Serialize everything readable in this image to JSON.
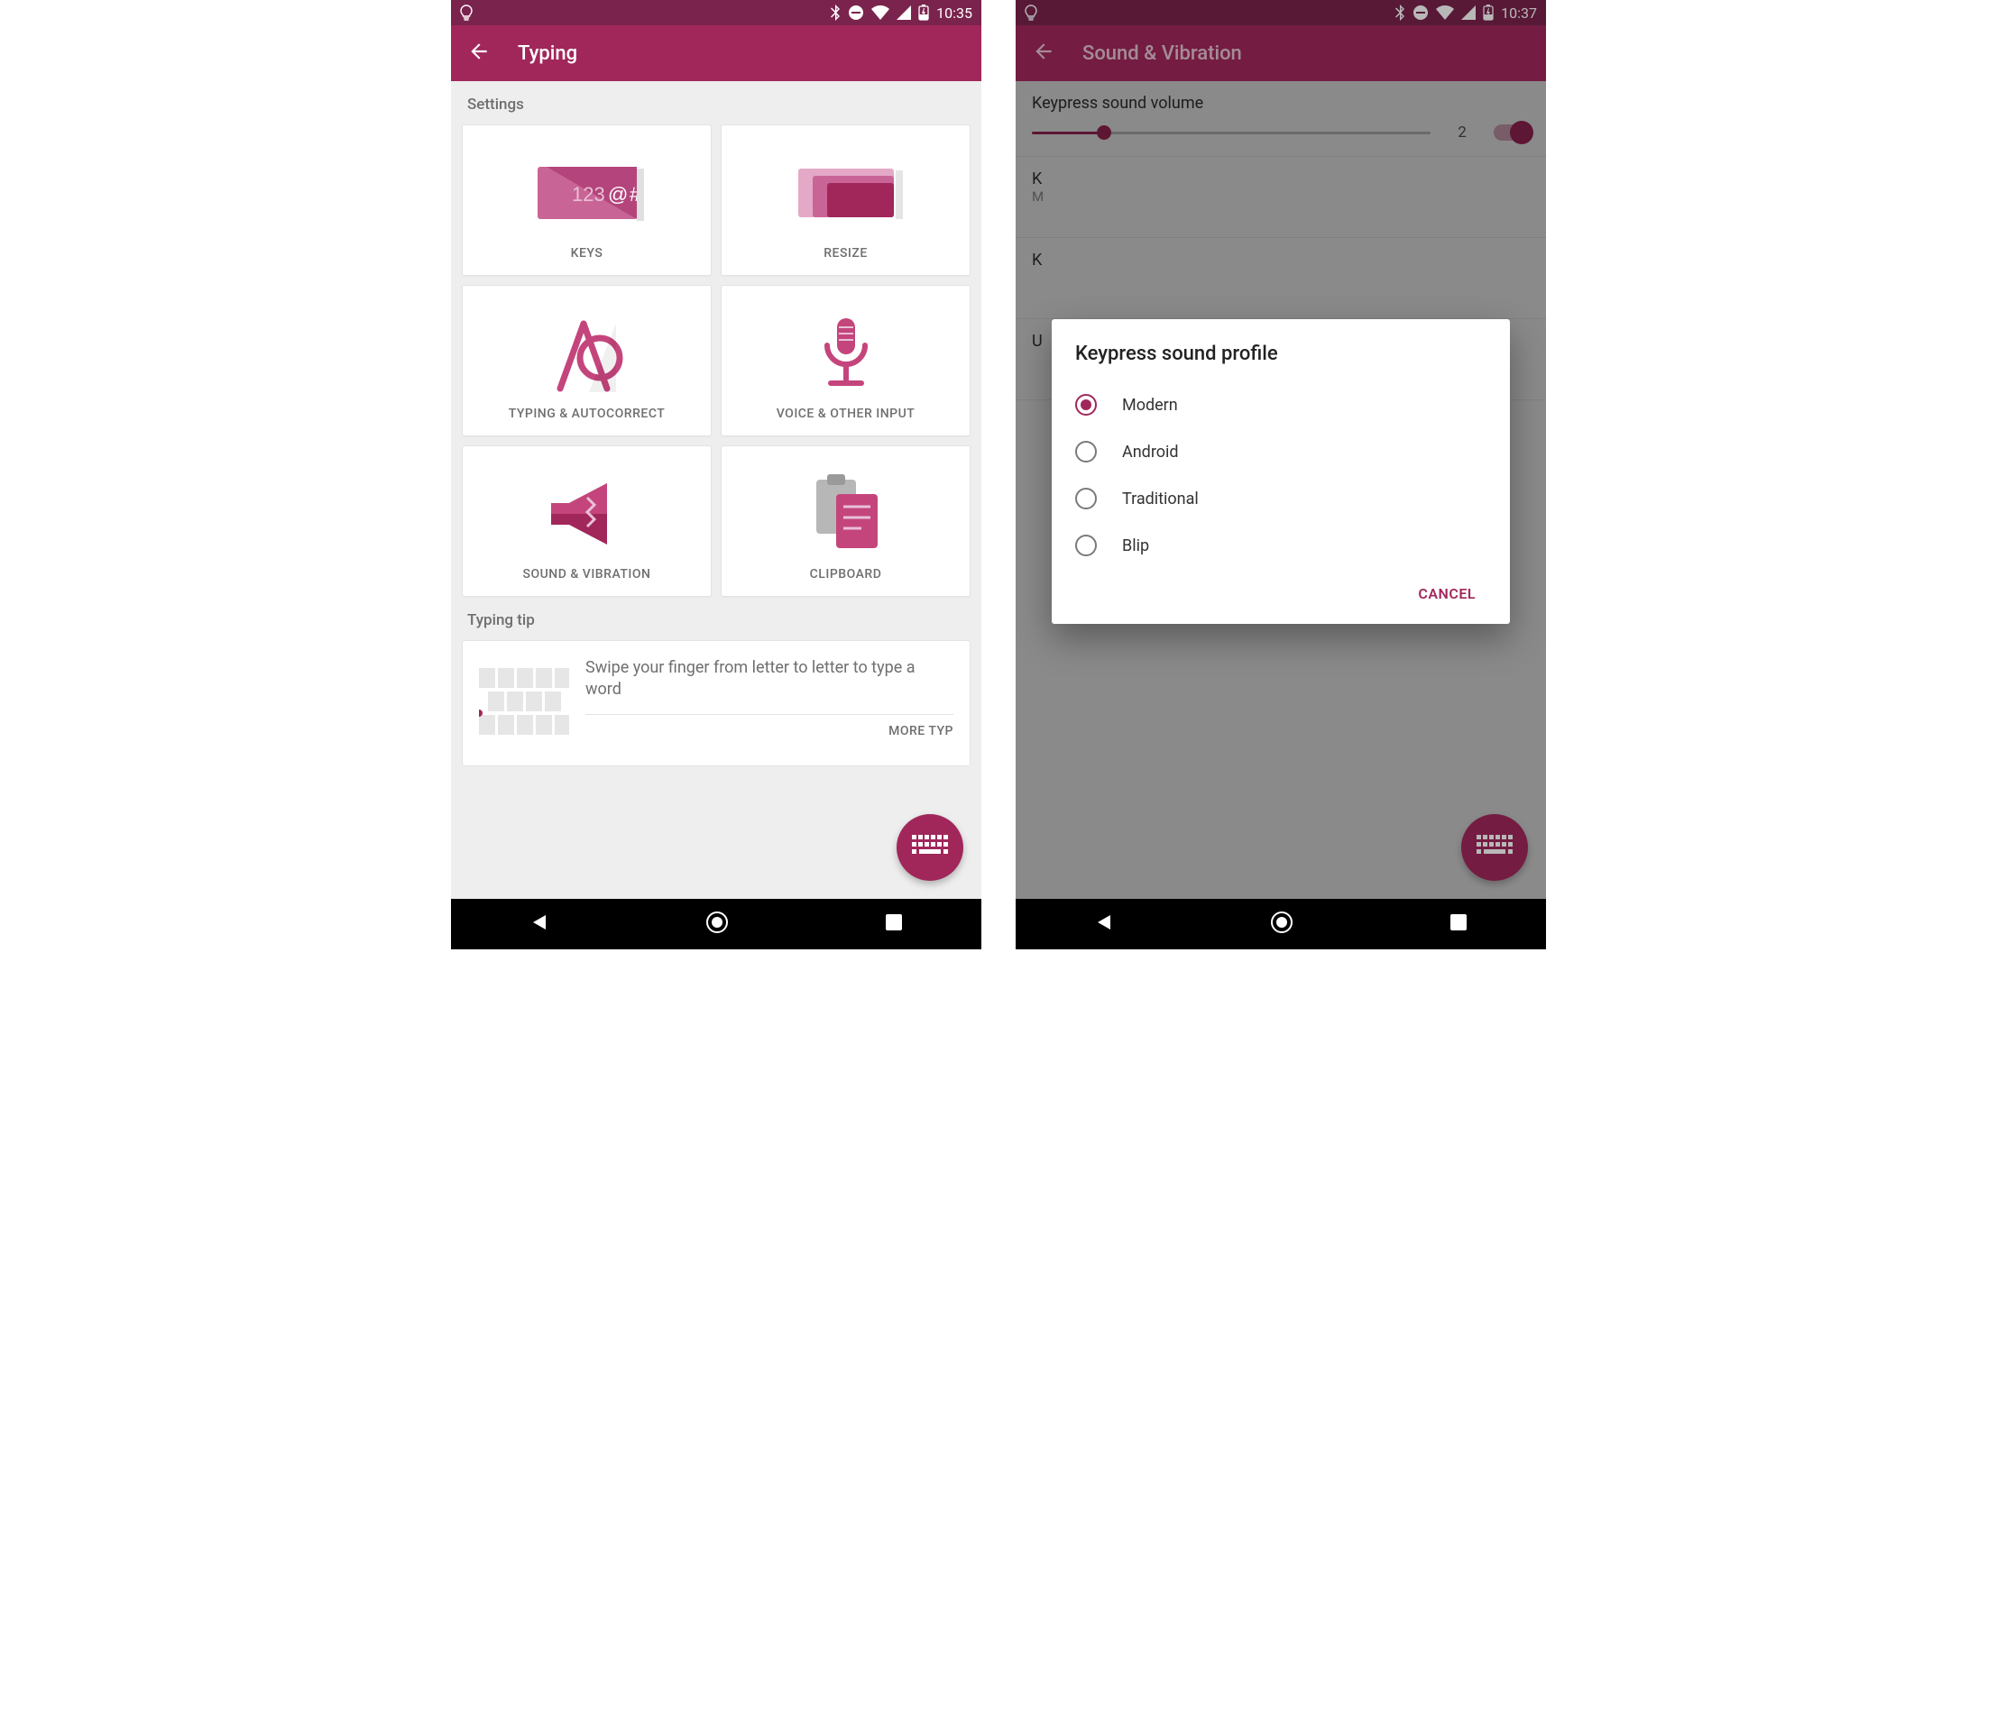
{
  "left": {
    "statusbar": {
      "time": "10:35"
    },
    "appbar": {
      "title": "Typing"
    },
    "sections": {
      "settings_label": "Settings",
      "tiles": [
        {
          "label": "KEYS"
        },
        {
          "label": "RESIZE"
        },
        {
          "label": "TYPING & AUTOCORRECT"
        },
        {
          "label": "VOICE & OTHER INPUT"
        },
        {
          "label": "SOUND & VIBRATION"
        },
        {
          "label": "CLIPBOARD"
        }
      ],
      "tip_label": "Typing tip",
      "tip_text": "Swipe your finger from letter to letter to type a word",
      "tip_action": "MORE TYP"
    }
  },
  "right": {
    "statusbar": {
      "time": "10:37"
    },
    "appbar": {
      "title": "Sound & Vibration"
    },
    "bg": {
      "volume_label": "Keypress sound volume",
      "volume_value": "2",
      "row2_letter": "K",
      "row2_sub": "M",
      "row3_letter": "K",
      "row4_letter": "U"
    },
    "dialog": {
      "title": "Keypress sound profile",
      "options": [
        {
          "label": "Modern",
          "selected": true
        },
        {
          "label": "Android",
          "selected": false
        },
        {
          "label": "Traditional",
          "selected": false
        },
        {
          "label": "Blip",
          "selected": false
        }
      ],
      "cancel": "CANCEL"
    }
  }
}
